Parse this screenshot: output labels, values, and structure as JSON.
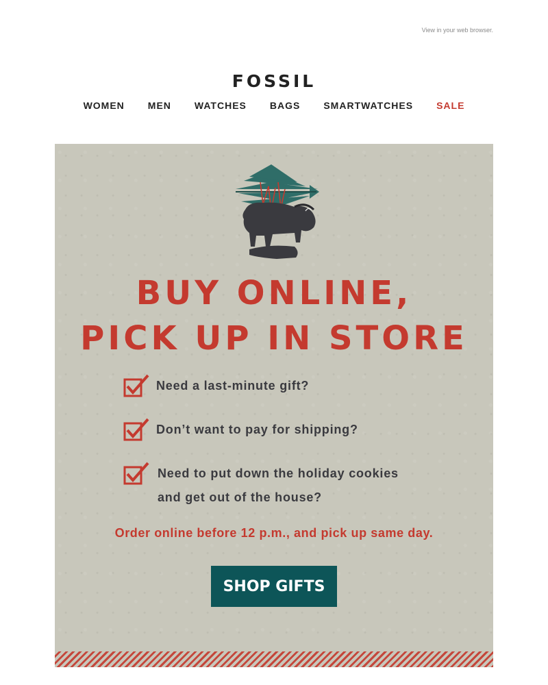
{
  "header": {
    "view_in_browser": "View in your web browser.",
    "logo": "FOSSIL"
  },
  "nav": {
    "items": [
      {
        "label": "WOMEN"
      },
      {
        "label": "MEN"
      },
      {
        "label": "WATCHES"
      },
      {
        "label": "BAGS"
      },
      {
        "label": "SMARTWATCHES"
      },
      {
        "label": "SALE"
      }
    ]
  },
  "hero": {
    "headline_line1": "BUY ONLINE,",
    "headline_line2": "PICK UP IN STORE",
    "checklist": [
      {
        "text": "Need a last-minute gift?"
      },
      {
        "text": "Don’t want to pay for shipping?"
      },
      {
        "text_line1": "Need to put down the holiday cookies",
        "text_line2": "and get out of the house?"
      }
    ],
    "note": "Order online before 12 p.m., and pick up same day.",
    "button_label": "SHOP GIFTS",
    "illustration_icon": "bison-with-christmas-tree-icon"
  },
  "colors": {
    "accent_red": "#c43a2f",
    "button_teal": "#0d5558",
    "hero_background": "#c8c7bb",
    "text_dark": "#3a3a3f"
  }
}
